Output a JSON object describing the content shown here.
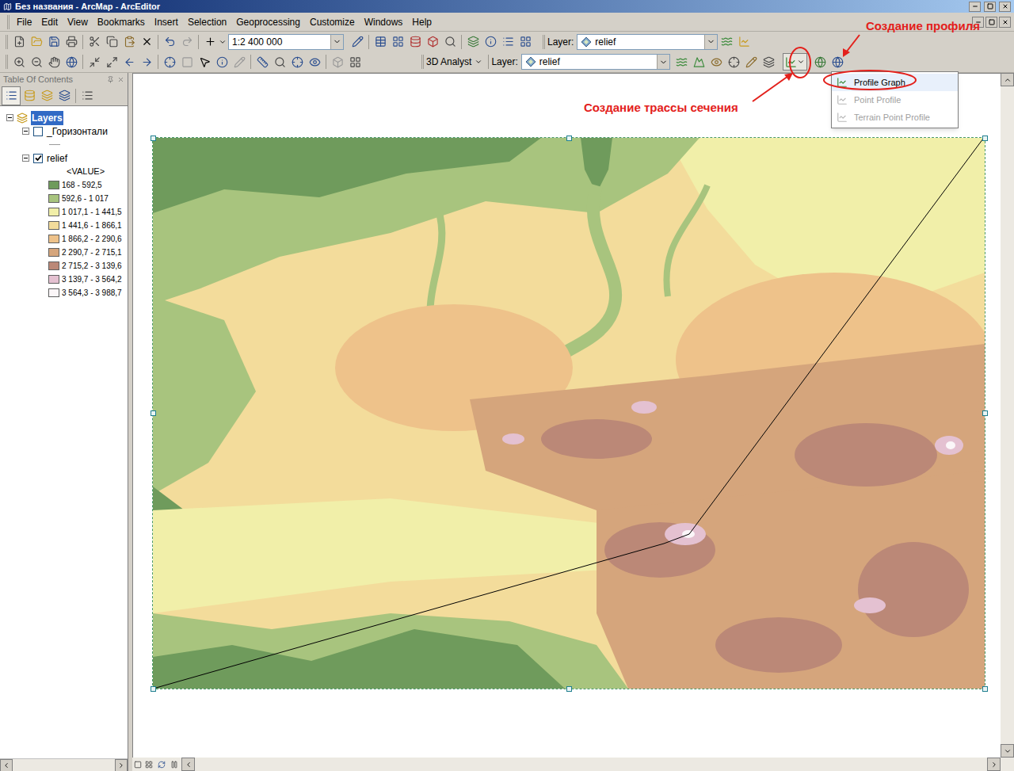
{
  "window": {
    "title": "Без названия - ArcMap - ArcEditor"
  },
  "menu": [
    "File",
    "Edit",
    "View",
    "Bookmarks",
    "Insert",
    "Selection",
    "Geoprocessing",
    "Customize",
    "Windows",
    "Help"
  ],
  "standard_toolbar": {
    "scale": "1:2 400 000",
    "layer_label": "Layer:",
    "layer": "relief"
  },
  "analyst_toolbar": {
    "name": "3D Analyst",
    "layer_label": "Layer:",
    "layer": "relief"
  },
  "toc": {
    "title": "Table Of Contents",
    "root": {
      "label": "Layers",
      "selected": true,
      "expanded": true
    },
    "layers": [
      {
        "name": "_Горизонтали",
        "checked": false,
        "expanded": true,
        "kind": "line",
        "legend_header": "",
        "classes": []
      },
      {
        "name": "relief",
        "checked": true,
        "expanded": true,
        "kind": "raster",
        "legend_header": "<VALUE>",
        "classes": [
          {
            "label": "168 - 592,5",
            "color": "#6f9b5c"
          },
          {
            "label": "592,6 - 1 017",
            "color": "#a8c47e"
          },
          {
            "label": "1 017,1 - 1 441,5",
            "color": "#f1efa9"
          },
          {
            "label": "1 441,6 - 1 866,1",
            "color": "#f3dc9b"
          },
          {
            "label": "1 866,2 - 2 290,6",
            "color": "#eec28a"
          },
          {
            "label": "2 290,7 - 2 715,1",
            "color": "#d5a57c"
          },
          {
            "label": "2 715,2 - 3 139,6",
            "color": "#bb8877"
          },
          {
            "label": "3 139,7 - 3 564,2",
            "color": "#e4c1d1"
          },
          {
            "label": "3 564,3 - 3 988,7",
            "color": "#fbf6f8"
          }
        ]
      }
    ]
  },
  "profile_menu": {
    "items": [
      {
        "label": "Profile Graph",
        "disabled": false,
        "selected": true
      },
      {
        "label": "Point Profile",
        "disabled": true,
        "selected": false
      },
      {
        "label": "Terrain Point Profile",
        "disabled": true,
        "selected": false
      }
    ]
  },
  "annotations": [
    {
      "text": "Создание профиля",
      "color": "#e3201b"
    },
    {
      "text": "Создание трассы сечения",
      "color": "#e3201b"
    }
  ]
}
